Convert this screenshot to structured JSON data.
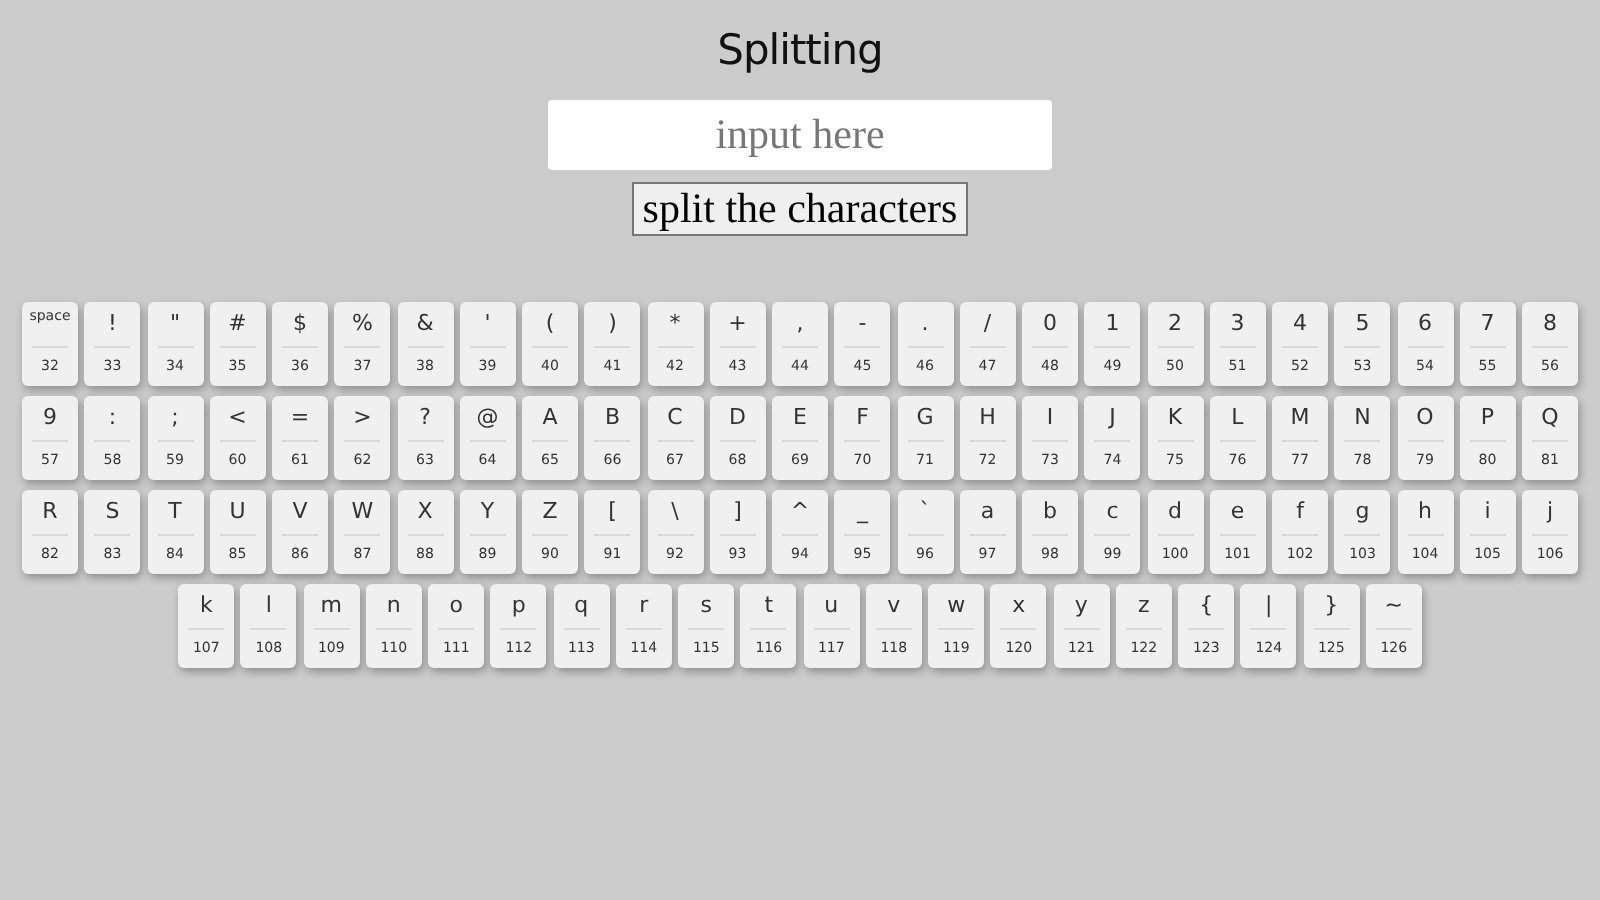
{
  "title": "Splitting",
  "input": {
    "placeholder": "input here"
  },
  "button": "split the characters",
  "cards": [
    {
      "char": "space",
      "code": "32"
    },
    {
      "char": "!",
      "code": "33"
    },
    {
      "char": "\"",
      "code": "34"
    },
    {
      "char": "#",
      "code": "35"
    },
    {
      "char": "$",
      "code": "36"
    },
    {
      "char": "%",
      "code": "37"
    },
    {
      "char": "&",
      "code": "38"
    },
    {
      "char": "'",
      "code": "39"
    },
    {
      "char": "(",
      "code": "40"
    },
    {
      "char": ")",
      "code": "41"
    },
    {
      "char": "*",
      "code": "42"
    },
    {
      "char": "+",
      "code": "43"
    },
    {
      "char": ",",
      "code": "44"
    },
    {
      "char": "-",
      "code": "45"
    },
    {
      "char": ".",
      "code": "46"
    },
    {
      "char": "/",
      "code": "47"
    },
    {
      "char": "0",
      "code": "48"
    },
    {
      "char": "1",
      "code": "49"
    },
    {
      "char": "2",
      "code": "50"
    },
    {
      "char": "3",
      "code": "51"
    },
    {
      "char": "4",
      "code": "52"
    },
    {
      "char": "5",
      "code": "53"
    },
    {
      "char": "6",
      "code": "54"
    },
    {
      "char": "7",
      "code": "55"
    },
    {
      "char": "8",
      "code": "56"
    },
    {
      "char": "9",
      "code": "57"
    },
    {
      "char": ":",
      "code": "58"
    },
    {
      "char": ";",
      "code": "59"
    },
    {
      "char": "<",
      "code": "60"
    },
    {
      "char": "=",
      "code": "61"
    },
    {
      "char": ">",
      "code": "62"
    },
    {
      "char": "?",
      "code": "63"
    },
    {
      "char": "@",
      "code": "64"
    },
    {
      "char": "A",
      "code": "65"
    },
    {
      "char": "B",
      "code": "66"
    },
    {
      "char": "C",
      "code": "67"
    },
    {
      "char": "D",
      "code": "68"
    },
    {
      "char": "E",
      "code": "69"
    },
    {
      "char": "F",
      "code": "70"
    },
    {
      "char": "G",
      "code": "71"
    },
    {
      "char": "H",
      "code": "72"
    },
    {
      "char": "I",
      "code": "73"
    },
    {
      "char": "J",
      "code": "74"
    },
    {
      "char": "K",
      "code": "75"
    },
    {
      "char": "L",
      "code": "76"
    },
    {
      "char": "M",
      "code": "77"
    },
    {
      "char": "N",
      "code": "78"
    },
    {
      "char": "O",
      "code": "79"
    },
    {
      "char": "P",
      "code": "80"
    },
    {
      "char": "Q",
      "code": "81"
    },
    {
      "char": "R",
      "code": "82"
    },
    {
      "char": "S",
      "code": "83"
    },
    {
      "char": "T",
      "code": "84"
    },
    {
      "char": "U",
      "code": "85"
    },
    {
      "char": "V",
      "code": "86"
    },
    {
      "char": "W",
      "code": "87"
    },
    {
      "char": "X",
      "code": "88"
    },
    {
      "char": "Y",
      "code": "89"
    },
    {
      "char": "Z",
      "code": "90"
    },
    {
      "char": "[",
      "code": "91"
    },
    {
      "char": "\\",
      "code": "92"
    },
    {
      "char": "]",
      "code": "93"
    },
    {
      "char": "^",
      "code": "94"
    },
    {
      "char": "_",
      "code": "95"
    },
    {
      "char": "`",
      "code": "96"
    },
    {
      "char": "a",
      "code": "97"
    },
    {
      "char": "b",
      "code": "98"
    },
    {
      "char": "c",
      "code": "99"
    },
    {
      "char": "d",
      "code": "100"
    },
    {
      "char": "e",
      "code": "101"
    },
    {
      "char": "f",
      "code": "102"
    },
    {
      "char": "g",
      "code": "103"
    },
    {
      "char": "h",
      "code": "104"
    },
    {
      "char": "i",
      "code": "105"
    },
    {
      "char": "j",
      "code": "106"
    },
    {
      "char": "k",
      "code": "107"
    },
    {
      "char": "l",
      "code": "108"
    },
    {
      "char": "m",
      "code": "109"
    },
    {
      "char": "n",
      "code": "110"
    },
    {
      "char": "o",
      "code": "111"
    },
    {
      "char": "p",
      "code": "112"
    },
    {
      "char": "q",
      "code": "113"
    },
    {
      "char": "r",
      "code": "114"
    },
    {
      "char": "s",
      "code": "115"
    },
    {
      "char": "t",
      "code": "116"
    },
    {
      "char": "u",
      "code": "117"
    },
    {
      "char": "v",
      "code": "118"
    },
    {
      "char": "w",
      "code": "119"
    },
    {
      "char": "x",
      "code": "120"
    },
    {
      "char": "y",
      "code": "121"
    },
    {
      "char": "z",
      "code": "122"
    },
    {
      "char": "{",
      "code": "123"
    },
    {
      "char": "|",
      "code": "124"
    },
    {
      "char": "}",
      "code": "125"
    },
    {
      "char": "~",
      "code": "126"
    }
  ]
}
